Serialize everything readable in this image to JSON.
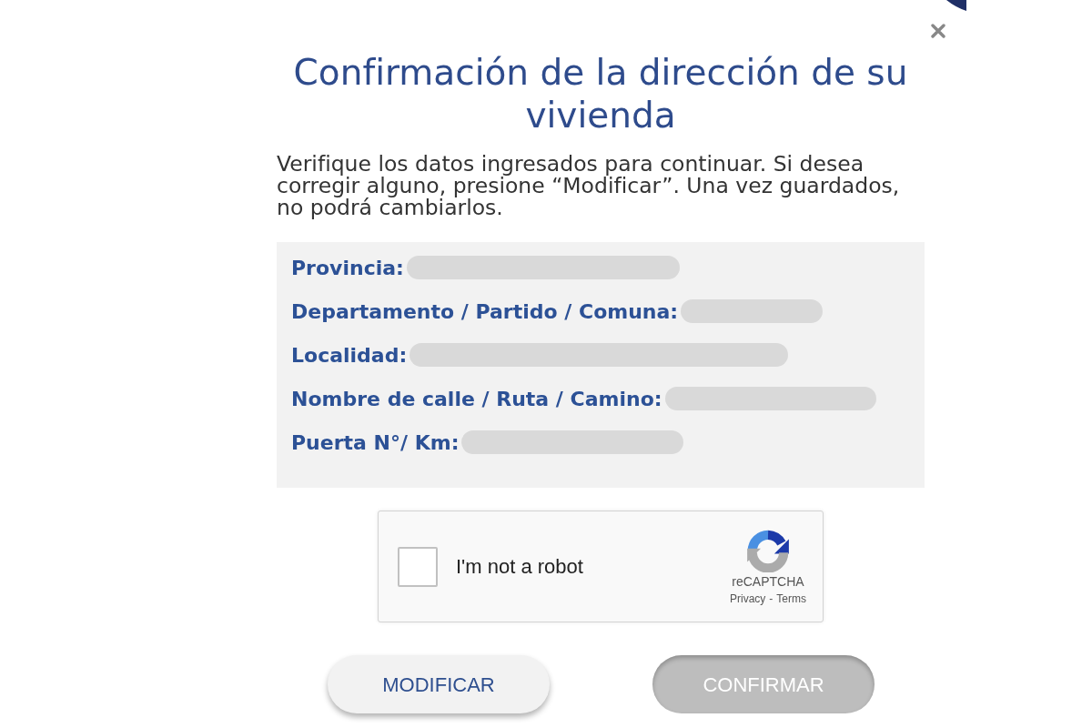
{
  "dialog": {
    "title": "Confirmación de la dirección de su vivienda",
    "message": "Verifique los datos ingresados para continuar. Si desea corregir alguno, presione “Modificar”. Una vez guardados, no podrá cambiarlos.",
    "fields": [
      {
        "label": "Provincia:",
        "redacted": true
      },
      {
        "label": "Departamento / Partido / Comuna:",
        "redacted": true
      },
      {
        "label": "Localidad:",
        "redacted": true
      },
      {
        "label": "Nombre de calle / Ruta / Camino:",
        "redacted": true
      },
      {
        "label": "Puerta N°/ Km:",
        "redacted": true
      }
    ],
    "captcha": {
      "label": "I'm not a robot",
      "checked": false,
      "brand": "reCAPTCHA",
      "privacy": "Privacy",
      "separator": "-",
      "terms": "Terms"
    },
    "buttons": [
      {
        "label": "MODIFICAR",
        "kind": "secondary",
        "disabled": false
      },
      {
        "label": "CONFIRMAR",
        "kind": "primary",
        "disabled": true
      }
    ]
  }
}
